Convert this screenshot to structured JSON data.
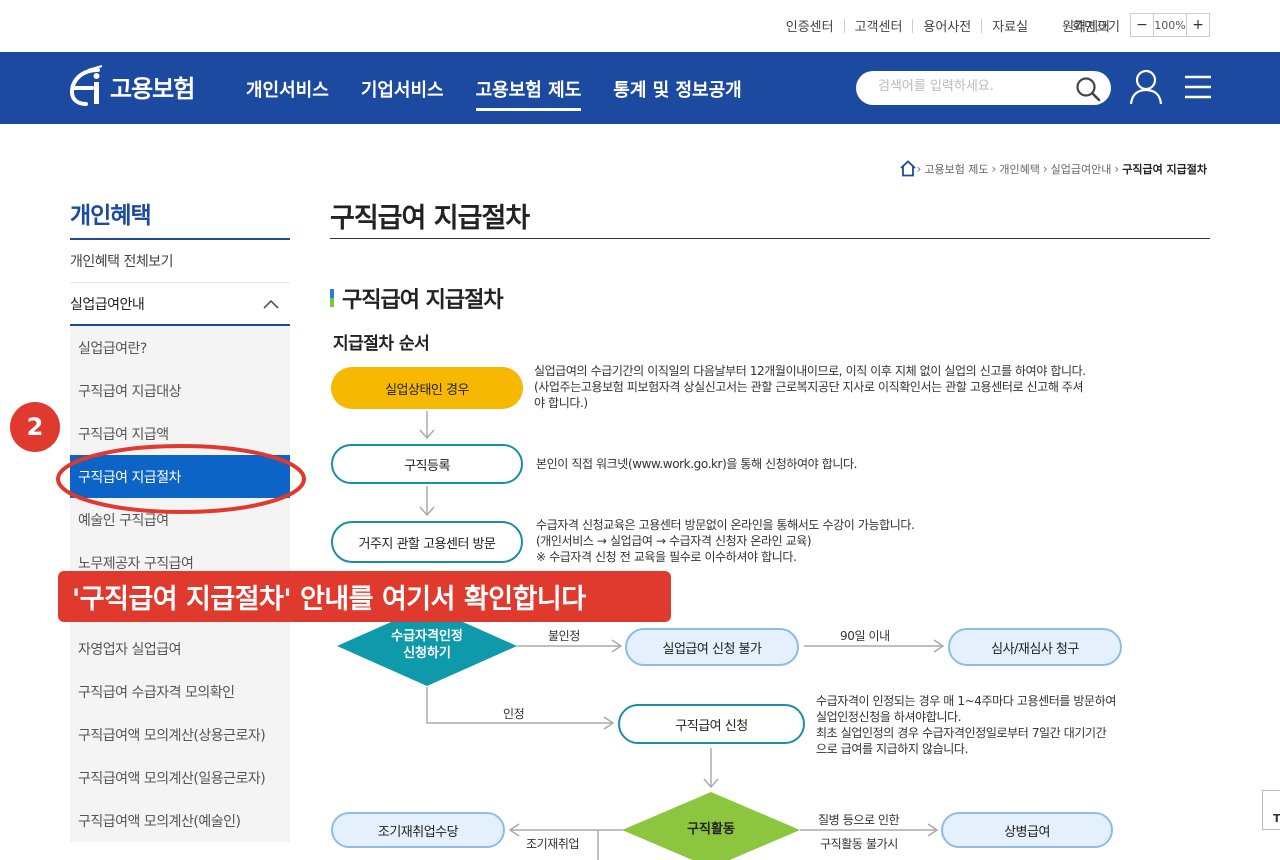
{
  "utility": {
    "links": [
      "인증센터",
      "고객센터",
      "용어사전",
      "자료실",
      "원격제어"
    ],
    "zoom_label": "화면크기",
    "zoom_minus": "−",
    "zoom_value": "100%",
    "zoom_plus": "+"
  },
  "header": {
    "logo_text": "고용보험",
    "nav": [
      "개인서비스",
      "기업서비스",
      "고용보험 제도",
      "통계 및 정보공개"
    ],
    "active_nav": "고용보험 제도",
    "search_placeholder": "검색어를 입력하세요."
  },
  "breadcrumb": [
    "고용보험 제도",
    "개인혜택",
    "실업급여안내",
    "구직급여 지급절차"
  ],
  "sidebar": {
    "title": "개인혜택",
    "items": [
      "개인혜택 전체보기",
      "실업급여안내"
    ],
    "sub_items": [
      "실업급여란?",
      "구직급여 지급대상",
      "구직급여 지급액",
      "구직급여 지급절차",
      "예술인 구직급여",
      "노무제공자 구직급여",
      "",
      "자영업자 실업급여",
      "구직급여 수급자격 모의확인",
      "구직급여액 모의계산(상용근로자)",
      "구직급여액 모의계산(일용근로자)",
      "구직급여액 모의계산(예술인)"
    ],
    "selected": "구직급여 지급절차"
  },
  "content": {
    "page_title": "구직급여 지급절차",
    "section_title": "구직급여 지급절차",
    "sub_title": "지급절차 순서"
  },
  "flow": {
    "step1": "실업상태인 경우",
    "step1_desc": [
      "실업급여의 수급기간의 이직일의 다음날부터 12개월이내이므로, 이직 이후 지체 없이 실업의 신고를 하여야 합니다.",
      "(사업주는고용보험 피보험자격 상실신고서는 관할 근로복지공단 지사로 이직확인서는 관할 고용센터로 신고해 주셔",
      "야 합니다.)"
    ],
    "step2": "구직등록",
    "step2_desc": "본인이 직접 워크넷(www.work.go.kr)을 통해 신청하여야 합니다.",
    "step3": "거주지 관할 고용센터 방문",
    "step3_desc": [
      "수급자격 신청교육은 고용센터 방문없이 온라인을 통해서도 수강이 가능합니다.",
      "(개인서비스 → 실업급여 → 수급자격 신청자 온라인 교육)",
      "※ 수급자격 신청 전 교육을 필수로 이수하셔야 합니다."
    ],
    "step4": [
      "수급자격인정",
      "신청하기"
    ],
    "rejected_label": "불인정",
    "rejected_box": "실업급여 신청 불가",
    "days_label": "90일 이내",
    "appeal_box": "심사/재심사 청구",
    "approved_label": "인정",
    "claim_box": "구직급여 신청",
    "claim_desc": [
      "수급자격이 인정되는 경우 매 1~4주마다 고용센터를 방문하여",
      "실업인정신청을 하셔야합니다.",
      "최초 실업인정의 경우 수급자격인정일로부터 7일간 대기기간",
      "으로 급여를 지급하지 않습니다."
    ],
    "activity": "구직활동",
    "early_label": "조기재취업",
    "early_box": "조기재취업수당",
    "sick_label1": "질병 등으로 인한",
    "sick_label2": "구직활동 불가시",
    "sick_box": "상병급여"
  },
  "annotation": {
    "badge": "2",
    "callout": "'구직급여 지급절차' 안내를 여기서 확인합니다"
  },
  "top_button": "TO",
  "colors": {
    "brand_blue": "#1c4aa0",
    "selected_blue": "#0c64c6",
    "annotation_red": "#e03a2f",
    "step_yellow": "#f6b800",
    "diamond_teal": "#0f9aab",
    "diamond_green": "#8cc63f"
  }
}
